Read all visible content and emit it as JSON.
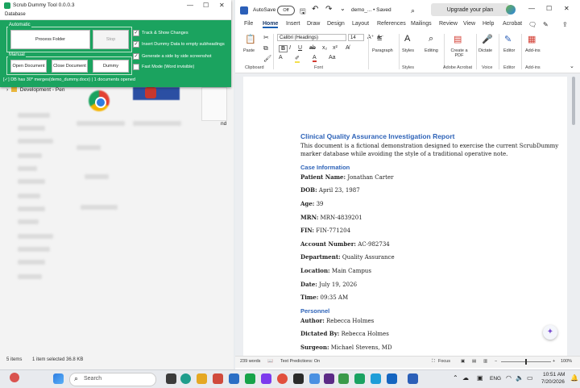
{
  "explorer": {
    "tree_item": "Development - Pen",
    "status_items": "5 items",
    "status_selected": "1 item selected  36.8 KB",
    "partial_text": "nd"
  },
  "scrub": {
    "title": "Scrub Dummy Tool 0.0.0.3",
    "menu": "Database",
    "automatic_label": "Automatic",
    "process_folder": "Process Folder",
    "stop": "Stop",
    "manual_label": "Manual",
    "open_document": "Open Document",
    "close_document": "Close Document",
    "dummy": "Dummy",
    "options": [
      {
        "label": "Track & Show Changes",
        "checked": true
      },
      {
        "label": "Insert Dummy Data to empty subheadings",
        "checked": true
      },
      {
        "label": "Generate a side by side screenshot",
        "checked": true
      },
      {
        "label": "Fast Mode (Word invisible)",
        "checked": false
      }
    ],
    "status": "[✓] DB has 30* merges(demo_dummy.docx) | 1 documents opened"
  },
  "word": {
    "autosave": "AutoSave",
    "autosave_state": "Off",
    "doc_name": "demo_... • Saved",
    "upgrade": "Upgrade your plan",
    "tabs": [
      "File",
      "Home",
      "Insert",
      "Draw",
      "Design",
      "Layout",
      "References",
      "Mailings",
      "Review",
      "View",
      "Help",
      "Acrobat"
    ],
    "font_name": "Calibri (Headings)",
    "font_size": "14",
    "groups": {
      "clipboard": "Clipboard",
      "paste": "Paste",
      "font": "Font",
      "paragraph": "Paragraph",
      "styles": "Styles",
      "editing": "Editing",
      "create_pdf": "Create a PDF",
      "adobe": "Adobe Acrobat",
      "dictate": "Dictate",
      "voice": "Voice",
      "editor": "Editor",
      "addins": "Add-ins"
    },
    "document": {
      "title": "Clinical Quality Assurance Investigation Report",
      "intro1": "This document is a fictional demonstration designed to exercise the current ScrubDummy",
      "intro2": "marker database while avoiding the style of a traditional operative note.",
      "case_heading": "Case Information",
      "fields": [
        {
          "label": "Patient Name:",
          "value": " Jonathan Carter"
        },
        {
          "label": "DOB:",
          "value": " April 23, 1987"
        },
        {
          "label": "Age:",
          "value": " 39"
        },
        {
          "label": "MRN:",
          "value": " MRN-4839201"
        },
        {
          "label": "FIN:",
          "value": " FIN-771204"
        },
        {
          "label": "Account Number:",
          "value": " AC-982734"
        },
        {
          "label": "Department:",
          "value": " Quality Assurance"
        },
        {
          "label": "Location:",
          "value": " Main Campus"
        },
        {
          "label": "Date:",
          "value": " July 19, 2026"
        },
        {
          "label": "Time:",
          "value": " 09:35 AM"
        }
      ],
      "personnel_heading": "Personnel",
      "personnel": [
        {
          "label": "Author:",
          "value": " Rebecca Holmes"
        },
        {
          "label": "Dictated By:",
          "value": " Rebecca Holmes"
        },
        {
          "label": "Surgeon:",
          "value": " Michael Stevens, MD"
        }
      ]
    },
    "status": {
      "words": "239 words",
      "predictions": "Text Predictions: On",
      "focus": "Focus",
      "zoom": "100%"
    }
  },
  "taskbar": {
    "search": "Search",
    "lang": "ENG",
    "time": "10:51 AM",
    "date": "7/20/2026"
  },
  "colors": {
    "scrub_green": "#1ba35f",
    "heading_blue": "#2e63b8"
  }
}
